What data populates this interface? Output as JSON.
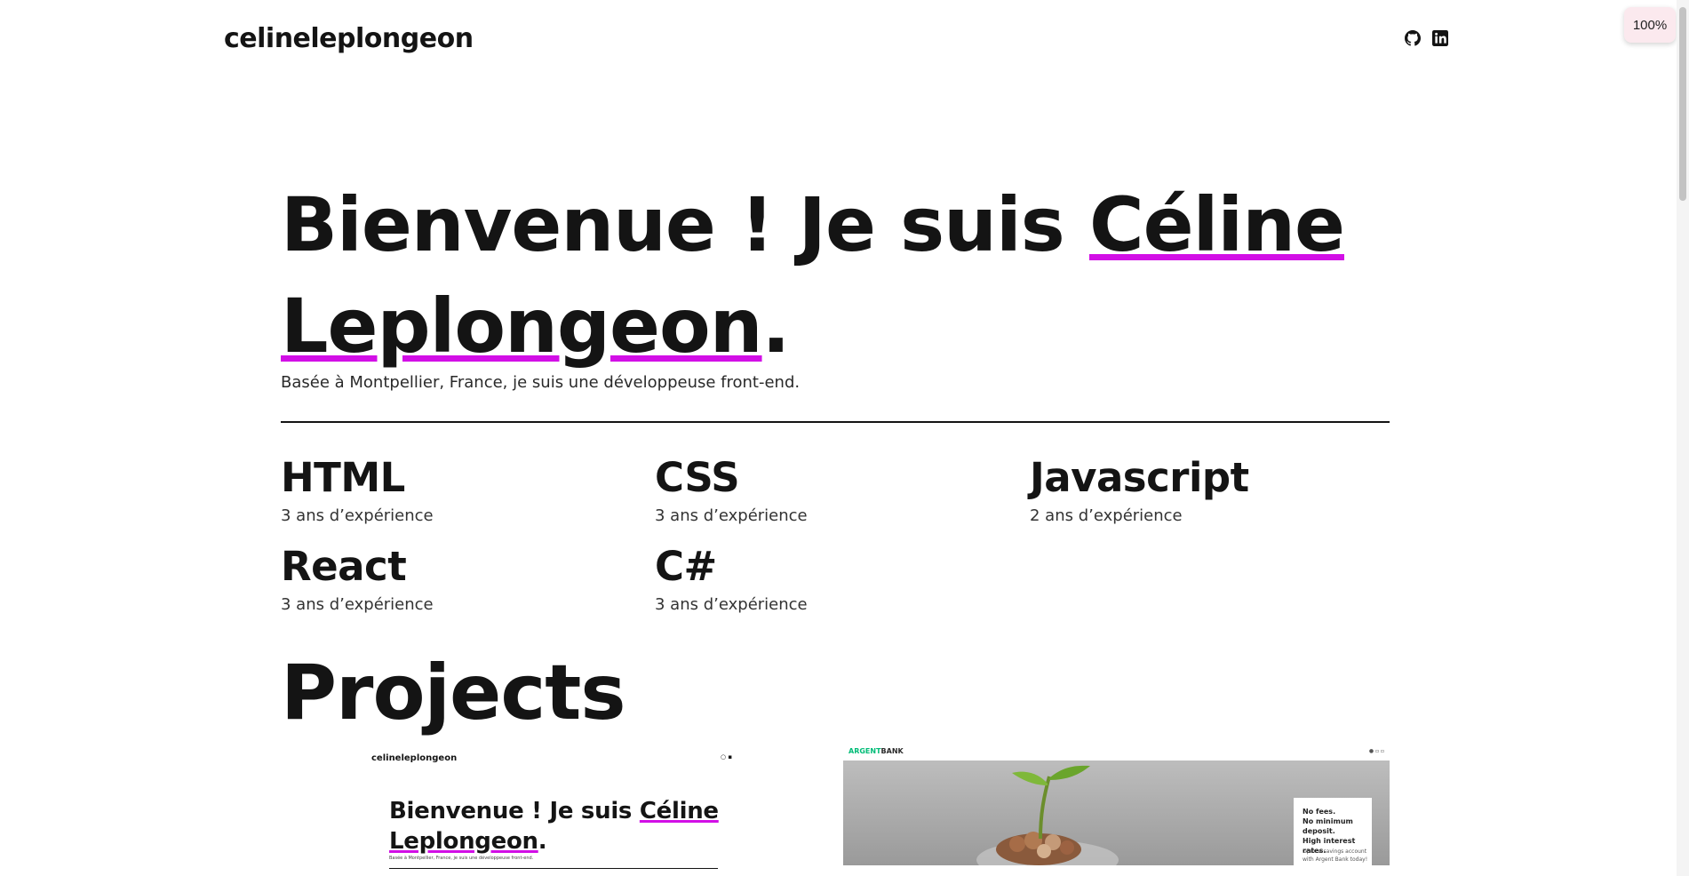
{
  "header": {
    "logo": "celineleplongeon",
    "github": "github-icon",
    "linkedin": "linkedin-icon"
  },
  "browser": {
    "zoom": "100%"
  },
  "hero": {
    "title_part1": "Bienvenue ! Je suis ",
    "title_name": "Céline Leplongeon",
    "title_end": ".",
    "subtitle": "Basée à Montpellier, France, je suis une développeuse front-end.",
    "highlight_color": "#d20fe6"
  },
  "skills": [
    {
      "name": "HTML",
      "experience": "3 ans d’expérience"
    },
    {
      "name": "CSS",
      "experience": "3 ans d’expérience"
    },
    {
      "name": "Javascript",
      "experience": "2 ans d’expérience"
    },
    {
      "name": "React",
      "experience": "3 ans d’expérience"
    },
    {
      "name": "C#",
      "experience": "3 ans d’expérience"
    }
  ],
  "projects": {
    "title": "Projects",
    "items": [
      {
        "logo": "celineleplongeon",
        "title_part1": "Bienvenue ! Je suis ",
        "title_name": "Céline Leplongeon",
        "title_end": ".",
        "subtitle": "Basée à Montpellier, France, je suis une développeuse front-end."
      },
      {
        "logo_accent": "ARGENT",
        "logo_rest": "BANK",
        "box_heading": "No fees.\nNo minimum deposit.\nHigh interest rates.",
        "box_text": "Open a savings account with Argent Bank today!",
        "accent_color": "#00bc77"
      }
    ]
  }
}
